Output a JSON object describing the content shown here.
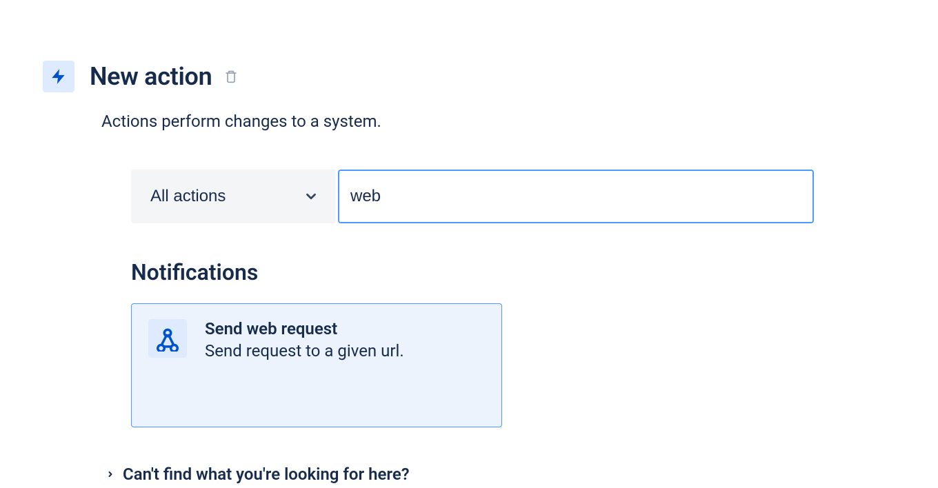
{
  "header": {
    "title": "New action"
  },
  "subtitle": "Actions perform changes to a system.",
  "filter": {
    "dropdown_label": "All actions",
    "search_value": "web"
  },
  "section": {
    "heading": "Notifications",
    "result": {
      "title": "Send web request",
      "description": "Send request to a given url."
    }
  },
  "footer": {
    "help_text": "Can't find what you're looking for here?"
  }
}
